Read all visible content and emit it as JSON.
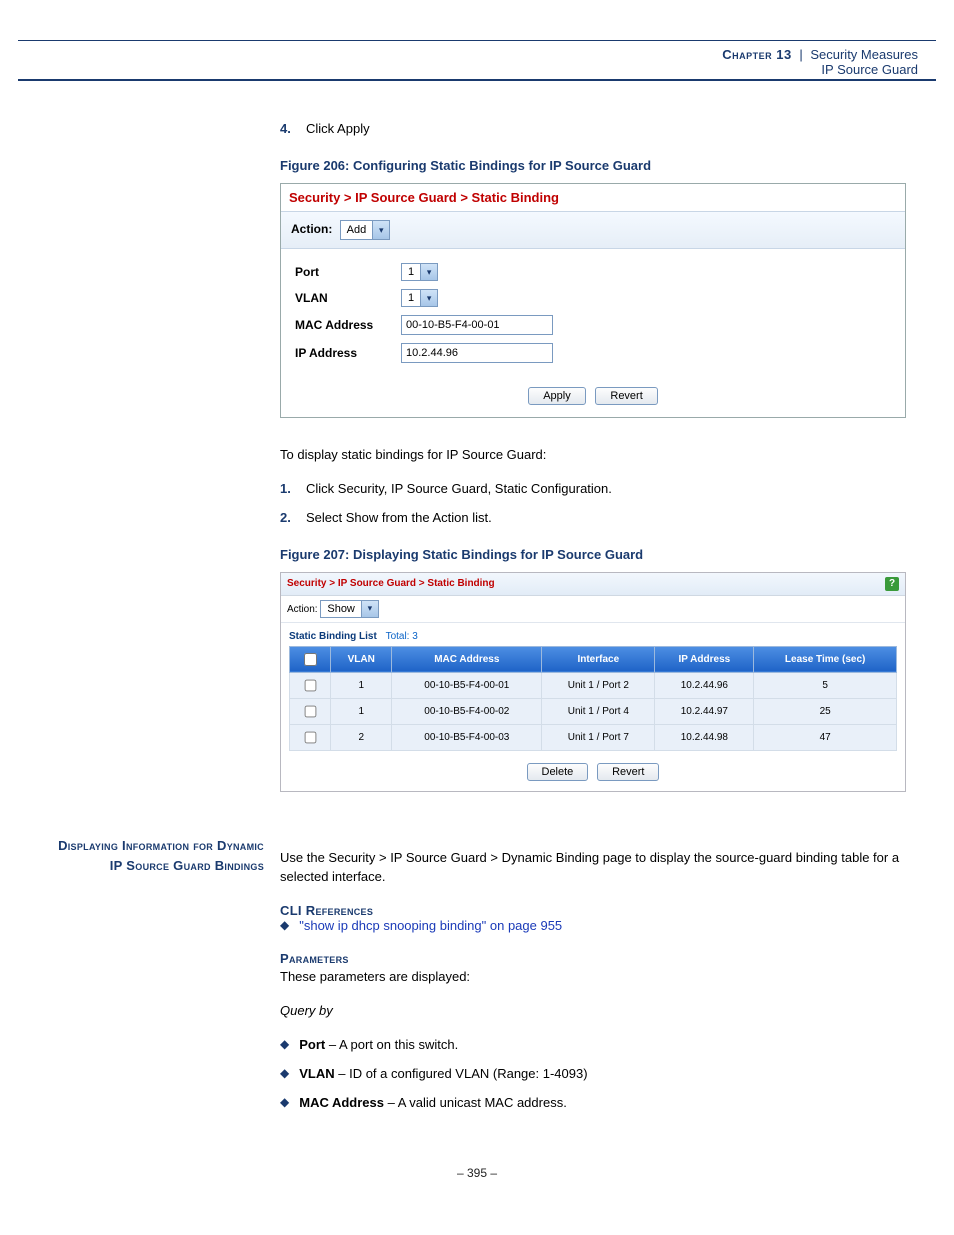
{
  "header": {
    "chapter_label": "Chapter 13",
    "separator": "|",
    "chapter_title": "Security Measures",
    "subtitle": "IP Source Guard"
  },
  "step4": {
    "num": "4.",
    "text": "Click Apply"
  },
  "figure206": {
    "caption": "Figure 206:  Configuring Static Bindings for IP Source Guard",
    "breadcrumb": "Security > IP Source Guard > Static Binding",
    "action_label": "Action:",
    "action_value": "Add",
    "fields": {
      "port_label": "Port",
      "port_value": "1",
      "vlan_label": "VLAN",
      "vlan_value": "1",
      "mac_label": "MAC Address",
      "mac_value": "00-10-B5-F4-00-01",
      "ip_label": "IP Address",
      "ip_value": "10.2.44.96"
    },
    "apply_btn": "Apply",
    "revert_btn": "Revert"
  },
  "display_intro": "To display static bindings for IP Source Guard:",
  "steps": [
    {
      "num": "1.",
      "text": "Click Security, IP Source Guard, Static Configuration."
    },
    {
      "num": "2.",
      "text": "Select Show from the Action list."
    }
  ],
  "figure207": {
    "caption": "Figure 207:  Displaying Static Bindings for IP Source Guard",
    "breadcrumb": "Security > IP Source Guard > Static Binding",
    "action_label": "Action:",
    "action_value": "Show",
    "list_title": "Static Binding List",
    "list_total_label": "Total:",
    "list_total_value": "3",
    "columns": [
      "",
      "VLAN",
      "MAC Address",
      "Interface",
      "IP Address",
      "Lease Time (sec)"
    ],
    "rows": [
      {
        "vlan": "1",
        "mac": "00-10-B5-F4-00-01",
        "iface": "Unit 1 / Port 2",
        "ip": "10.2.44.96",
        "lease": "5"
      },
      {
        "vlan": "1",
        "mac": "00-10-B5-F4-00-02",
        "iface": "Unit 1 / Port 4",
        "ip": "10.2.44.97",
        "lease": "25"
      },
      {
        "vlan": "2",
        "mac": "00-10-B5-F4-00-03",
        "iface": "Unit 1 / Port 7",
        "ip": "10.2.44.98",
        "lease": "47"
      }
    ],
    "delete_btn": "Delete",
    "revert_btn": "Revert"
  },
  "section": {
    "side_heading": "Displaying Information for Dynamic IP Source Guard Bindings",
    "intro": "Use the Security > IP Source Guard > Dynamic Binding page to display the source-guard binding table for a selected interface.",
    "cli_heading": "CLI References",
    "cli_link": "\"show ip dhcp snooping binding\" on page 955",
    "params_heading": "Parameters",
    "params_intro": "These parameters are displayed:",
    "query_by": "Query by",
    "bullets": [
      {
        "bold": "Port",
        "rest": " – A port on this switch."
      },
      {
        "bold": "VLAN",
        "rest": " – ID of a configured VLAN (Range: 1-4093)"
      },
      {
        "bold": "MAC Address",
        "rest": " – A valid unicast MAC address."
      }
    ]
  },
  "footer": {
    "pagenum": "–  395  –"
  }
}
